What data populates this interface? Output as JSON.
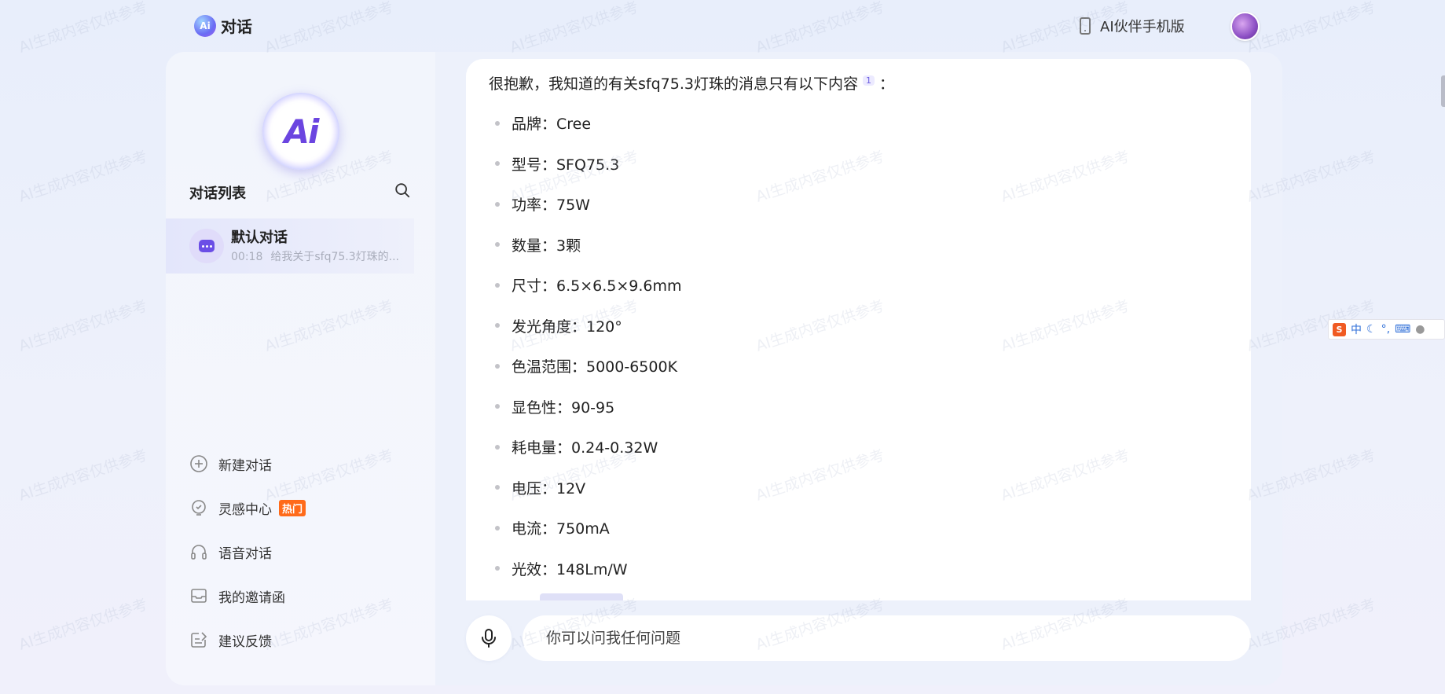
{
  "header": {
    "logo_text": "Ai",
    "title": "对话",
    "mobile_link": "AI伙伴手机版"
  },
  "sidebar": {
    "orb_text": "Ai",
    "list_title": "对话列表",
    "conversation": {
      "name": "默认对话",
      "time": "00:18",
      "preview": "给我关于sfq75.3灯珠的..."
    },
    "menu": [
      {
        "label": "新建对话",
        "icon": "plus-circle-icon"
      },
      {
        "label": "灵感中心",
        "icon": "lightbulb-icon",
        "badge": "热门"
      },
      {
        "label": "语音对话",
        "icon": "headphones-icon"
      },
      {
        "label": "我的邀请函",
        "icon": "envelope-icon"
      },
      {
        "label": "建议反馈",
        "icon": "feedback-icon"
      }
    ]
  },
  "chat": {
    "intro_before": "很抱歉，我知道的有关sfq75.3灯珠的消息只有以下内容",
    "citation": "1",
    "intro_after": "：",
    "specs": [
      "品牌：Cree",
      "型号：SFQ75.3",
      "功率：75W",
      "数量：3颗",
      "尺寸：6.5×6.5×9.6mm",
      "发光角度：120°",
      "色温范围：5000-6500K",
      "显色性：90-95",
      "耗电量：0.24-0.32W",
      "电压：12V",
      "电流：750mA",
      "光效：148Lm/W"
    ]
  },
  "input": {
    "placeholder": "你可以问我任何问题"
  },
  "watermark": "AI生成内容仅供参考",
  "ime": {
    "logo": "S",
    "mode": "中"
  },
  "colors": {
    "accent": "#6b4ee6",
    "badge": "#ff6a1a",
    "background": "#e8eefb"
  }
}
